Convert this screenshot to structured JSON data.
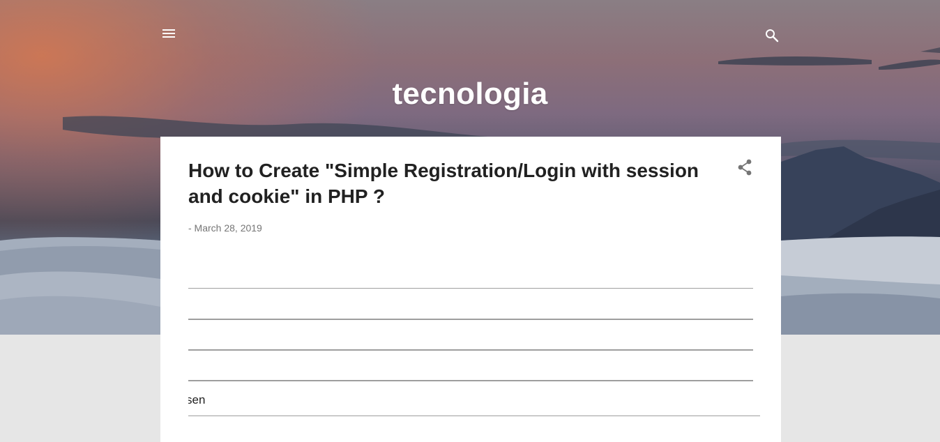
{
  "header": {
    "blog_title": "tecnologia",
    "menu_icon": "hamburger-menu-icon",
    "search_icon": "search-icon"
  },
  "post": {
    "title": "How to Create \"Simple Registration/Login with session and cookie\" in PHP ?",
    "date": "- March 28, 2019",
    "share_icon": "share-icon",
    "snippet_text": "sen"
  },
  "colors": {
    "page_background": "#e6e6e6",
    "card_background": "#ffffff",
    "title_text": "#212121",
    "date_text": "#757575",
    "header_text": "#ffffff"
  }
}
